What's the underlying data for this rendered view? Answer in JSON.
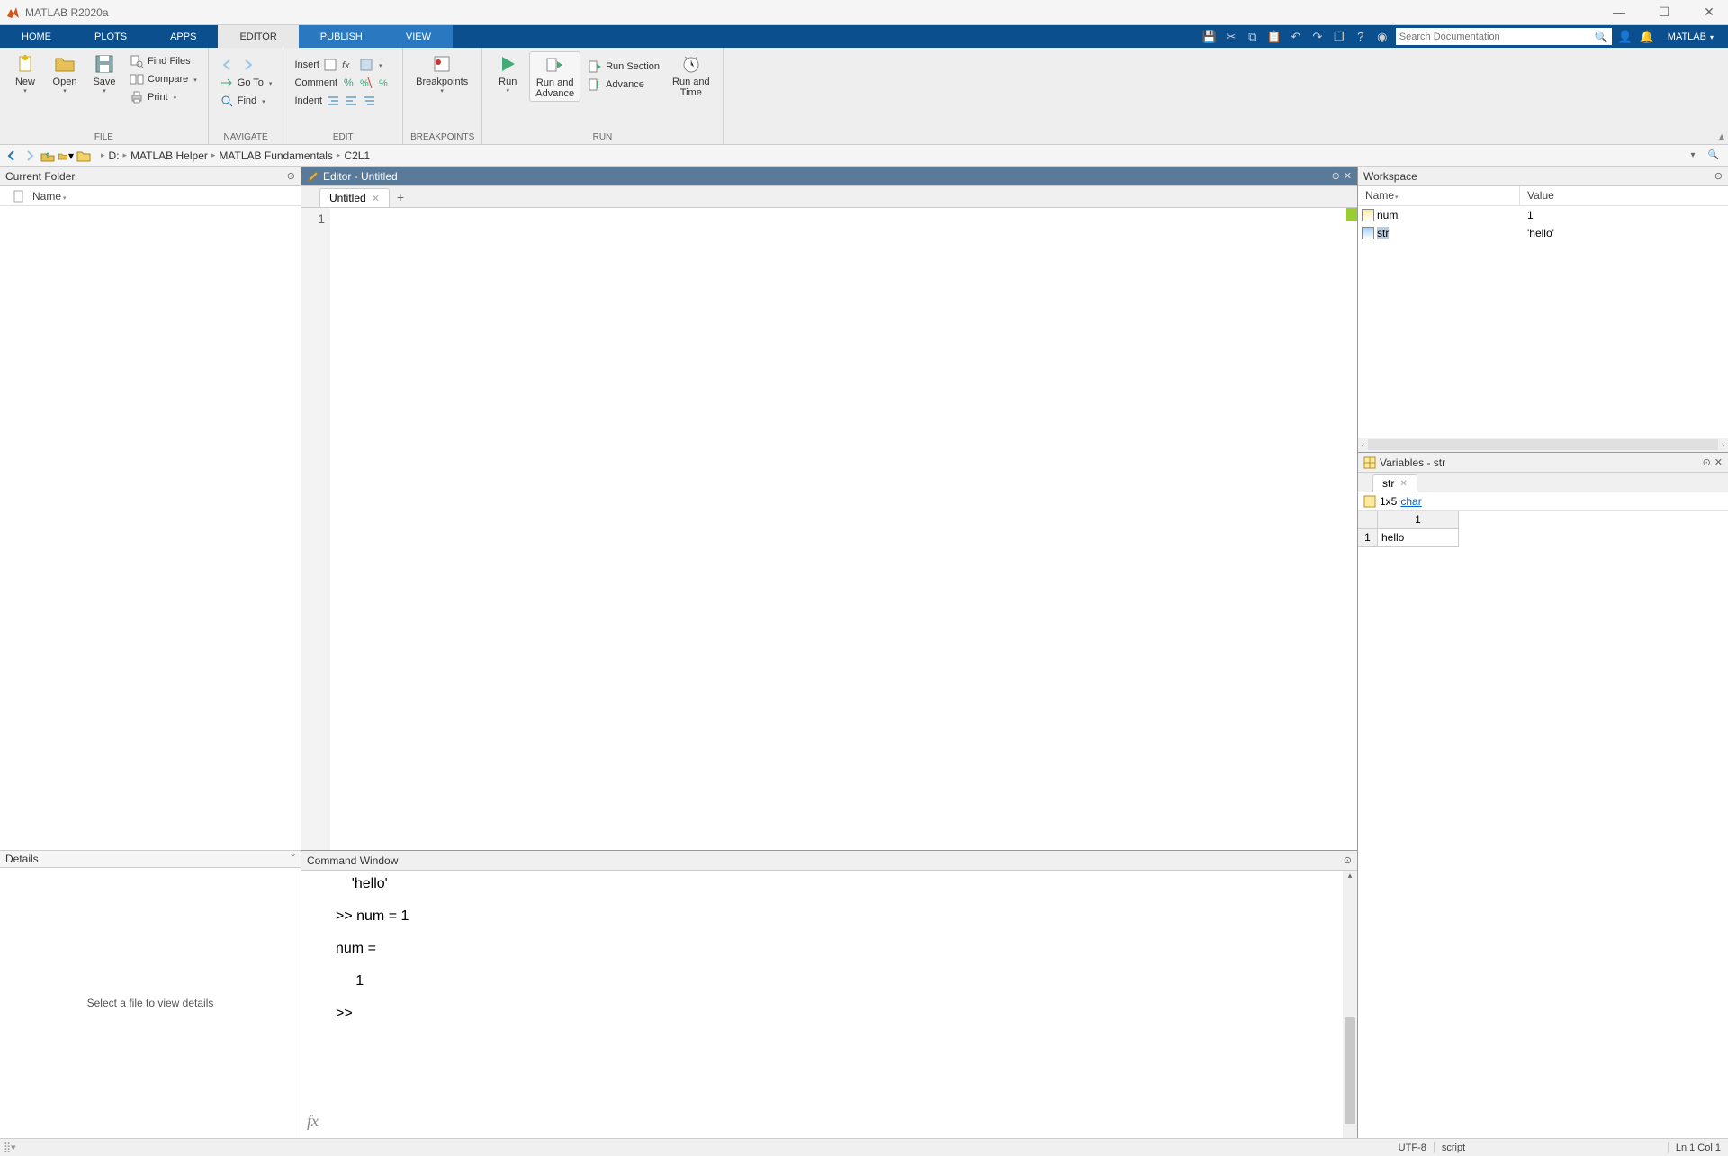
{
  "app": {
    "title": "MATLAB R2020a"
  },
  "tabs": {
    "home": "HOME",
    "plots": "PLOTS",
    "apps": "APPS",
    "editor": "EDITOR",
    "publish": "PUBLISH",
    "view": "VIEW"
  },
  "search": {
    "placeholder": "Search Documentation"
  },
  "login": "MATLAB",
  "ribbon": {
    "file": {
      "label": "FILE",
      "new": "New",
      "open": "Open",
      "save": "Save",
      "find_files": "Find Files",
      "compare": "Compare",
      "print": "Print"
    },
    "navigate": {
      "label": "NAVIGATE",
      "goto": "Go To",
      "find": "Find"
    },
    "edit": {
      "label": "EDIT",
      "insert": "Insert",
      "comment": "Comment",
      "indent": "Indent"
    },
    "breakpoints": {
      "label": "BREAKPOINTS",
      "btn": "Breakpoints"
    },
    "run": {
      "label": "RUN",
      "run": "Run",
      "run_advance": "Run and\nAdvance",
      "run_section": "Run Section",
      "advance": "Advance",
      "run_time": "Run and\nTime"
    }
  },
  "address": {
    "drive": "D:",
    "crumbs": [
      "MATLAB Helper",
      "MATLAB Fundamentals",
      "C2L1"
    ]
  },
  "current_folder": {
    "title": "Current Folder",
    "name_col": "Name"
  },
  "details": {
    "title": "Details",
    "empty": "Select a file to view details"
  },
  "editor": {
    "header": "Editor - Untitled",
    "tab": "Untitled",
    "line1": "1"
  },
  "command": {
    "title": "Command Window",
    "content": "    'hello'\n\n>> num = 1\n\nnum =\n\n     1\n\n>> "
  },
  "workspace": {
    "title": "Workspace",
    "cols": {
      "name": "Name",
      "value": "Value"
    },
    "rows": [
      {
        "name": "num",
        "value": "1",
        "type": "num"
      },
      {
        "name": "str",
        "value": "'hello'",
        "type": "str",
        "selected": true
      }
    ]
  },
  "variables": {
    "title": "Variables - str",
    "tab": "str",
    "dims": "1x5",
    "dtype": "char",
    "col1": "1",
    "row1": "1",
    "cell": "hello"
  },
  "status": {
    "encoding": "UTF-8",
    "mode": "script",
    "pos": "Ln  1   Col  1"
  }
}
